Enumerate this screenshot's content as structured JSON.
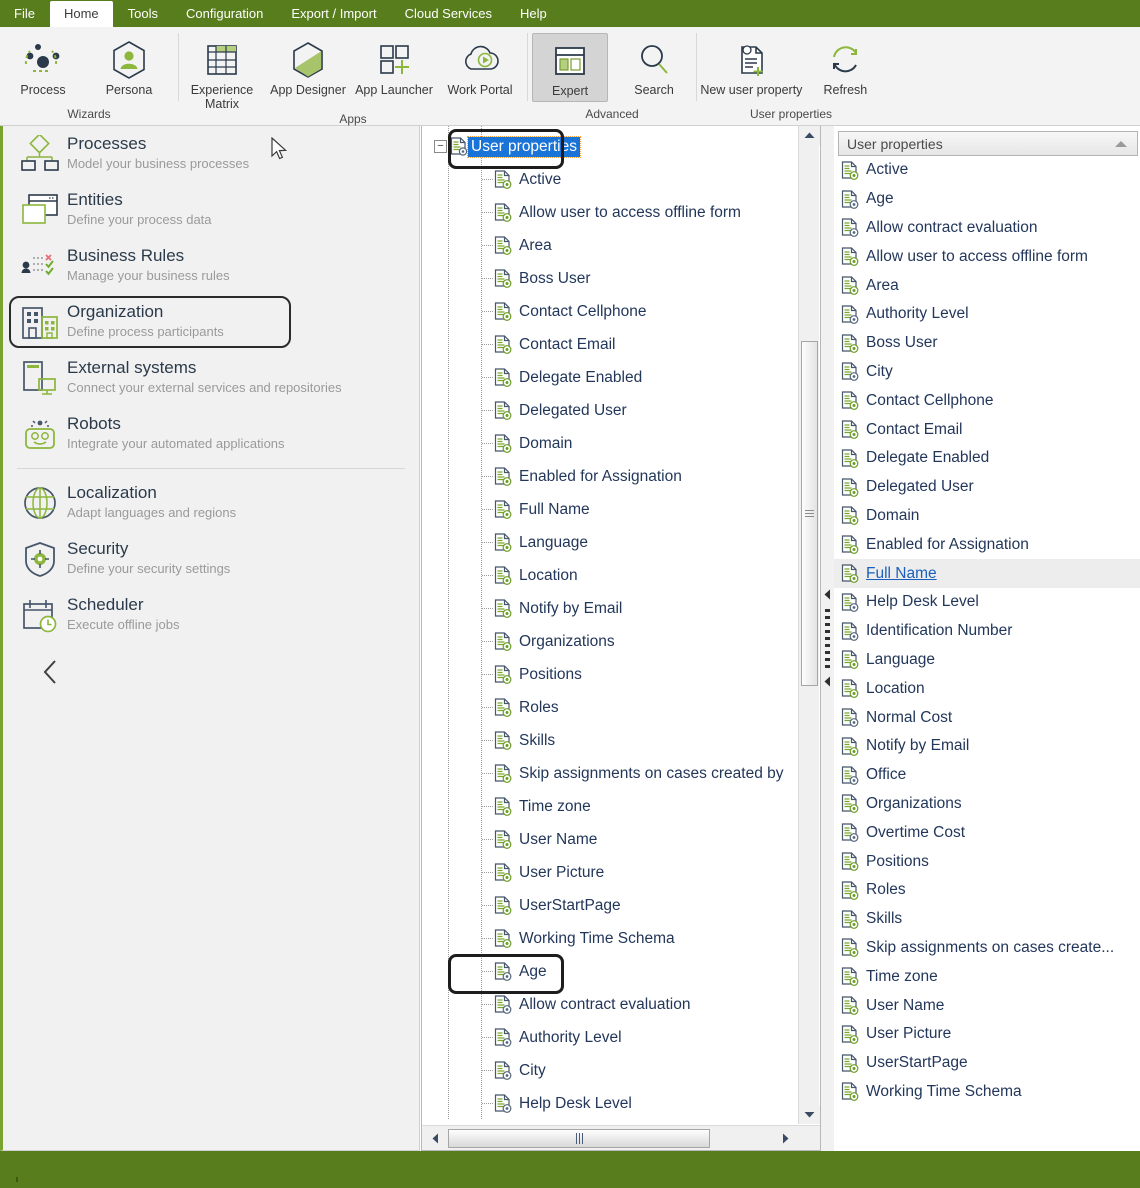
{
  "menubar": {
    "items": [
      {
        "label": "File",
        "active": false
      },
      {
        "label": "Home",
        "active": true
      },
      {
        "label": "Tools",
        "active": false
      },
      {
        "label": "Configuration",
        "active": false
      },
      {
        "label": "Export / Import",
        "active": false
      },
      {
        "label": "Cloud Services",
        "active": false
      },
      {
        "label": "Help",
        "active": false
      }
    ]
  },
  "ribbon": {
    "groups": [
      {
        "label": "Wizards",
        "buttons": [
          {
            "label": "Process",
            "icon": "process-icon"
          },
          {
            "label": "Persona",
            "icon": "persona-icon"
          }
        ]
      },
      {
        "label": "Apps",
        "buttons": [
          {
            "label": "Experience Matrix",
            "icon": "experience-matrix-icon"
          },
          {
            "label": "App Designer",
            "icon": "app-designer-icon"
          },
          {
            "label": "App Launcher",
            "icon": "app-launcher-icon"
          },
          {
            "label": "Work Portal",
            "icon": "work-portal-icon"
          }
        ]
      },
      {
        "label": "Advanced",
        "buttons": [
          {
            "label": "Expert",
            "icon": "expert-icon",
            "selected": true
          },
          {
            "label": "Search",
            "icon": "search-icon"
          }
        ]
      },
      {
        "label": "User properties",
        "buttons": [
          {
            "label": "New user property",
            "icon": "new-user-property-icon"
          },
          {
            "label": "Refresh",
            "icon": "refresh-icon"
          }
        ]
      }
    ]
  },
  "sidebar": {
    "items": [
      {
        "title": "Processes",
        "subtitle": "Model your business processes",
        "icon": "processes-icon",
        "selected": false
      },
      {
        "title": "Entities",
        "subtitle": "Define your process data",
        "icon": "entities-icon",
        "selected": false
      },
      {
        "title": "Business  Rules",
        "subtitle": "Manage your business rules",
        "icon": "business-rules-icon",
        "selected": false
      },
      {
        "title": "Organization",
        "subtitle": "Define process participants",
        "icon": "organization-icon",
        "selected": true
      },
      {
        "title": "External systems",
        "subtitle": "Connect your external services and repositories",
        "icon": "external-systems-icon",
        "selected": false
      },
      {
        "title": "Robots",
        "subtitle": "Integrate your automated applications",
        "icon": "robots-icon",
        "selected": false
      }
    ],
    "items2": [
      {
        "title": "Localization",
        "subtitle": "Adapt languages and regions",
        "icon": "localization-icon"
      },
      {
        "title": "Security",
        "subtitle": "Define your security settings",
        "icon": "security-icon"
      },
      {
        "title": "Scheduler",
        "subtitle": "Execute offline jobs",
        "icon": "scheduler-icon"
      }
    ],
    "collapse_icon": "chevron-left-icon"
  },
  "tree": {
    "root": {
      "label": "User properties",
      "expander": "−",
      "icon": "user-property-icon",
      "selected": true,
      "boxed": true
    },
    "nodes": [
      {
        "label": "Active",
        "state": "green"
      },
      {
        "label": "Allow user to access offline form",
        "state": "green"
      },
      {
        "label": "Area",
        "state": "green"
      },
      {
        "label": "Boss User",
        "state": "green"
      },
      {
        "label": "Contact Cellphone",
        "state": "green"
      },
      {
        "label": "Contact Email",
        "state": "green"
      },
      {
        "label": "Delegate Enabled",
        "state": "green"
      },
      {
        "label": "Delegated User",
        "state": "green"
      },
      {
        "label": "Domain",
        "state": "green"
      },
      {
        "label": "Enabled for Assignation",
        "state": "green"
      },
      {
        "label": "Full Name",
        "state": "green"
      },
      {
        "label": "Language",
        "state": "green"
      },
      {
        "label": "Location",
        "state": "green"
      },
      {
        "label": "Notify by Email",
        "state": "green"
      },
      {
        "label": "Organizations",
        "state": "green"
      },
      {
        "label": "Positions",
        "state": "green"
      },
      {
        "label": "Roles",
        "state": "green"
      },
      {
        "label": "Skills",
        "state": "green"
      },
      {
        "label": "Skip assignments on cases created by",
        "state": "green"
      },
      {
        "label": "Time zone",
        "state": "green"
      },
      {
        "label": "User Name",
        "state": "green"
      },
      {
        "label": "User Picture",
        "state": "green"
      },
      {
        "label": "UserStartPage",
        "state": "green"
      },
      {
        "label": "Working Time Schema",
        "state": "green"
      },
      {
        "label": "Age",
        "state": "grey",
        "boxed": true
      },
      {
        "label": "Allow contract evaluation",
        "state": "grey"
      },
      {
        "label": "Authority Level",
        "state": "grey"
      },
      {
        "label": "City",
        "state": "grey"
      },
      {
        "label": "Help Desk Level",
        "state": "grey"
      }
    ],
    "vscroll": {
      "up_icon": "scroll-up-icon",
      "down_icon": "scroll-down-icon"
    },
    "hscroll": {
      "left_icon": "scroll-left-icon",
      "right_icon": "scroll-right-icon"
    }
  },
  "splitter": {
    "top_arrow": "collapse-left-icon",
    "bottom_arrow": "collapse-left-icon"
  },
  "list": {
    "header": {
      "title": "User properties",
      "sort_icon": "sort-ascending-icon"
    },
    "items": [
      {
        "label": "Active",
        "state": "green",
        "selected": false
      },
      {
        "label": "Age",
        "state": "grey",
        "selected": false
      },
      {
        "label": "Allow contract evaluation",
        "state": "grey",
        "selected": false
      },
      {
        "label": "Allow user to access offline form",
        "state": "green",
        "selected": false
      },
      {
        "label": "Area",
        "state": "green",
        "selected": false
      },
      {
        "label": "Authority Level",
        "state": "grey",
        "selected": false
      },
      {
        "label": "Boss User",
        "state": "green",
        "selected": false
      },
      {
        "label": "City",
        "state": "grey",
        "selected": false
      },
      {
        "label": "Contact Cellphone",
        "state": "green",
        "selected": false
      },
      {
        "label": "Contact Email",
        "state": "green",
        "selected": false
      },
      {
        "label": "Delegate Enabled",
        "state": "green",
        "selected": false
      },
      {
        "label": "Delegated User",
        "state": "green",
        "selected": false
      },
      {
        "label": "Domain",
        "state": "green",
        "selected": false
      },
      {
        "label": "Enabled for Assignation",
        "state": "green",
        "selected": false
      },
      {
        "label": "Full Name",
        "state": "green",
        "selected": true
      },
      {
        "label": "Help Desk Level",
        "state": "grey",
        "selected": false
      },
      {
        "label": "Identification Number",
        "state": "grey",
        "selected": false
      },
      {
        "label": "Language",
        "state": "green",
        "selected": false
      },
      {
        "label": "Location",
        "state": "green",
        "selected": false
      },
      {
        "label": "Normal Cost",
        "state": "grey",
        "selected": false
      },
      {
        "label": "Notify by Email",
        "state": "green",
        "selected": false
      },
      {
        "label": "Office",
        "state": "grey",
        "selected": false
      },
      {
        "label": "Organizations",
        "state": "green",
        "selected": false
      },
      {
        "label": "Overtime Cost",
        "state": "grey",
        "selected": false
      },
      {
        "label": "Positions",
        "state": "green",
        "selected": false
      },
      {
        "label": "Roles",
        "state": "green",
        "selected": false
      },
      {
        "label": "Skills",
        "state": "green",
        "selected": false
      },
      {
        "label": "Skip assignments on cases create...",
        "state": "green",
        "selected": false
      },
      {
        "label": "Time zone",
        "state": "green",
        "selected": false
      },
      {
        "label": "User Name",
        "state": "green",
        "selected": false
      },
      {
        "label": "User Picture",
        "state": "green",
        "selected": false
      },
      {
        "label": "UserStartPage",
        "state": "green",
        "selected": false
      },
      {
        "label": "Working Time Schema",
        "state": "green",
        "selected": false
      }
    ]
  },
  "colors": {
    "brand_green": "#587d1c",
    "accent_green": "#8cb63c",
    "text_navy": "#23375a",
    "selection_blue": "#1a73d6",
    "link_blue": "#1a5fbd"
  },
  "cursor": {
    "icon": "mouse-pointer-icon"
  }
}
